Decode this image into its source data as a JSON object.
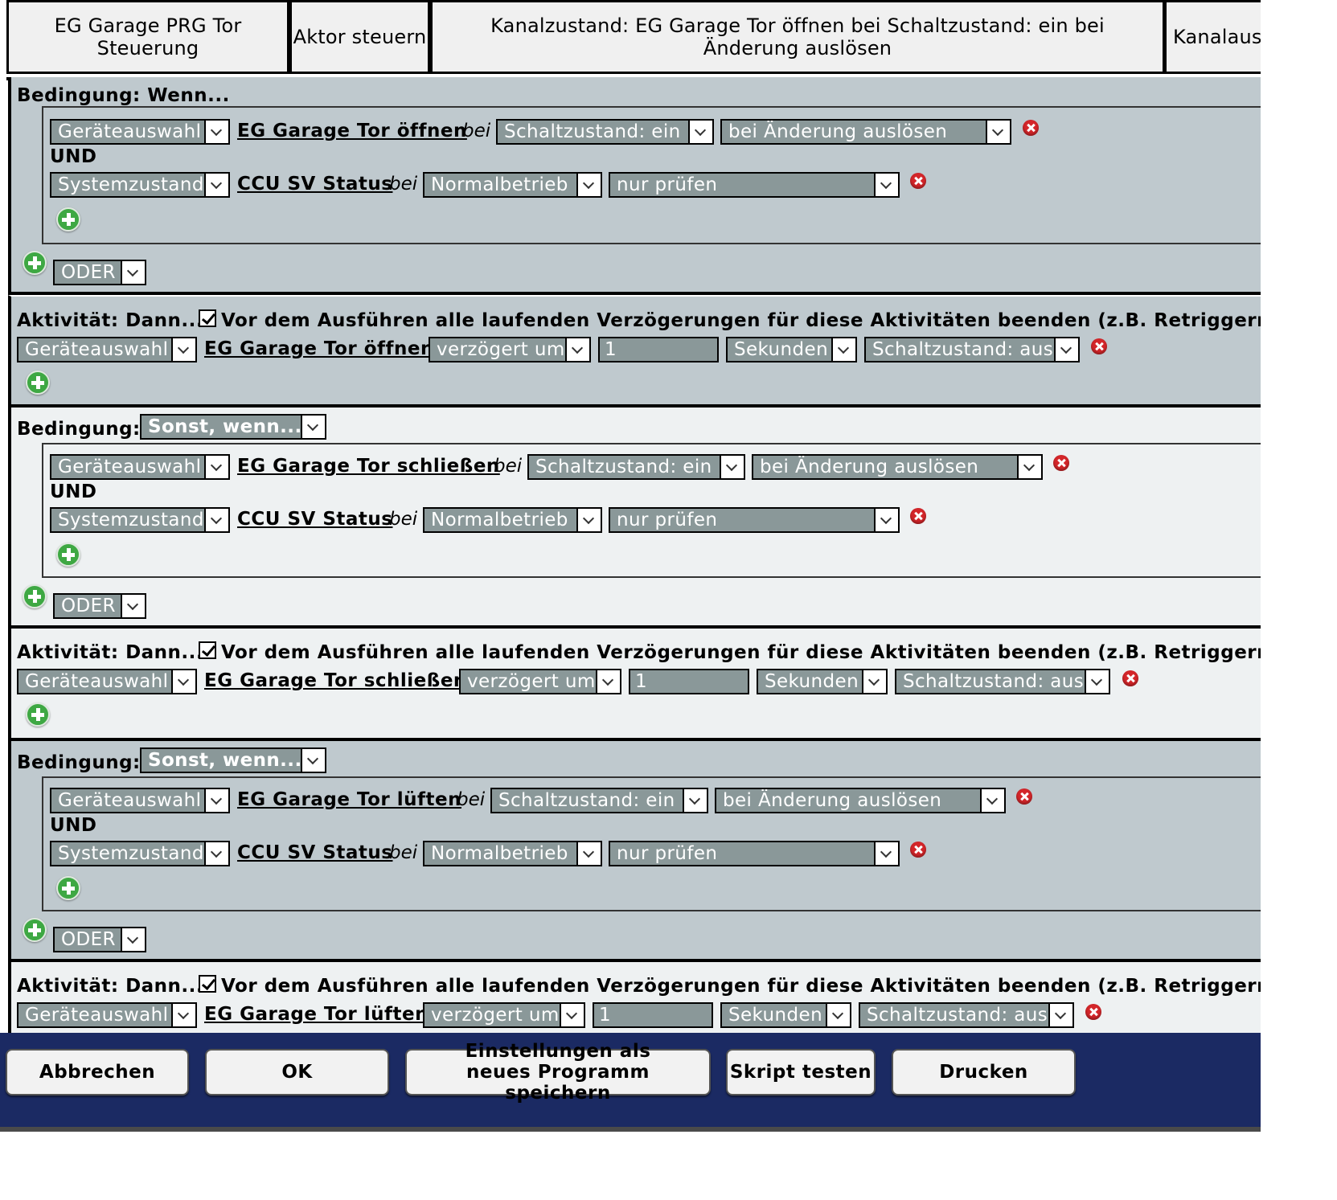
{
  "header": {
    "program_name": "EG Garage PRG Tor Steuerung",
    "action": "Aktor steuern",
    "description": "Kanalzustand: EG Garage Tor öffnen bei Schaltzustand: ein bei Änderung auslösen",
    "channel": "Kanalausw"
  },
  "labels": {
    "if": "Bedingung: Wenn...",
    "condition": "Bedingung:",
    "then": "Aktivität: Dann...",
    "and": "UND",
    "or": "ODER",
    "bei": "bei",
    "retrigger": "Vor dem Ausführen alle laufenden Verzögerungen für diese Aktivitäten beenden (z.B. Retriggern)."
  },
  "blocks": [
    {
      "condition_type": "Wenn...",
      "conditions": [
        {
          "type": "Geräteauswahl",
          "device": "EG Garage Tor öffnen",
          "state": "Schaltzustand: ein",
          "trigger": "bei Änderung auslösen"
        },
        {
          "type": "Systemzustand",
          "device": "CCU SV Status",
          "state": "Normalbetrieb",
          "trigger": "nur prüfen"
        }
      ],
      "activity": {
        "type": "Geräteauswahl",
        "device": "EG Garage Tor öffnen",
        "timing": "verzögert um",
        "delay": "1",
        "unit": "Sekunden",
        "value": "Schaltzustand: aus",
        "retrigger": true
      }
    },
    {
      "condition_type": "Sonst, wenn...",
      "conditions": [
        {
          "type": "Geräteauswahl",
          "device": "EG Garage Tor schließen",
          "state": "Schaltzustand: ein",
          "trigger": "bei Änderung auslösen"
        },
        {
          "type": "Systemzustand",
          "device": "CCU SV Status",
          "state": "Normalbetrieb",
          "trigger": "nur prüfen"
        }
      ],
      "activity": {
        "type": "Geräteauswahl",
        "device": "EG Garage Tor schließen",
        "timing": "verzögert um",
        "delay": "1",
        "unit": "Sekunden",
        "value": "Schaltzustand: aus",
        "retrigger": true
      }
    },
    {
      "condition_type": "Sonst, wenn...",
      "conditions": [
        {
          "type": "Geräteauswahl",
          "device": "EG Garage Tor lüften",
          "state": "Schaltzustand: ein",
          "trigger": "bei Änderung auslösen"
        },
        {
          "type": "Systemzustand",
          "device": "CCU SV Status",
          "state": "Normalbetrieb",
          "trigger": "nur prüfen"
        }
      ],
      "activity": {
        "type": "Geräteauswahl",
        "device": "EG Garage Tor lüften",
        "timing": "verzögert um",
        "delay": "1",
        "unit": "Sekunden",
        "value": "Schaltzustand: aus",
        "retrigger": true
      }
    }
  ],
  "footer": {
    "cancel": "Abbrechen",
    "ok": "OK",
    "save_as_new": "Einstellungen als neues Programm speichern",
    "test_script": "Skript testen",
    "print": "Drucken"
  },
  "colors": {
    "grey_section": "#bfc9ce",
    "light_section": "#eef1f2",
    "select_bg": "#8a9899",
    "footer_bg": "#1b2a63",
    "delete_red": "#d4262a",
    "add_green": "#3ea843"
  },
  "icons": [
    "plus-circle-icon",
    "delete-x-icon",
    "chevron-down-icon",
    "checkbox-checked-icon"
  ]
}
